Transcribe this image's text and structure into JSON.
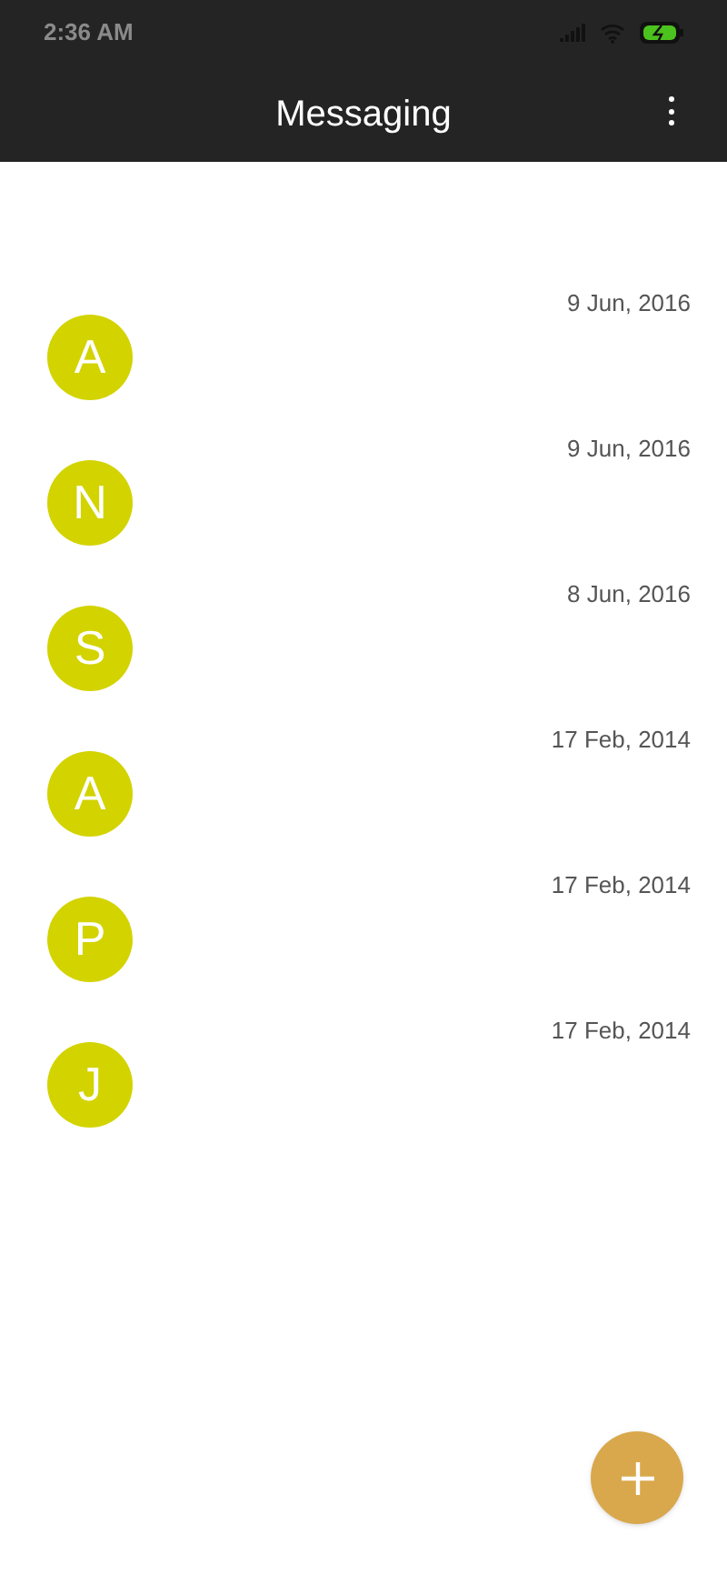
{
  "status_bar": {
    "time": "2:36 AM"
  },
  "app_bar": {
    "title": "Messaging"
  },
  "conversations": [
    {
      "initial": "A",
      "date": "9 Jun, 2016"
    },
    {
      "initial": "N",
      "date": "9 Jun, 2016"
    },
    {
      "initial": "S",
      "date": "8 Jun, 2016"
    },
    {
      "initial": "A",
      "date": "17 Feb, 2014"
    },
    {
      "initial": "P",
      "date": "17 Feb, 2014"
    },
    {
      "initial": "J",
      "date": "17 Feb, 2014"
    }
  ]
}
